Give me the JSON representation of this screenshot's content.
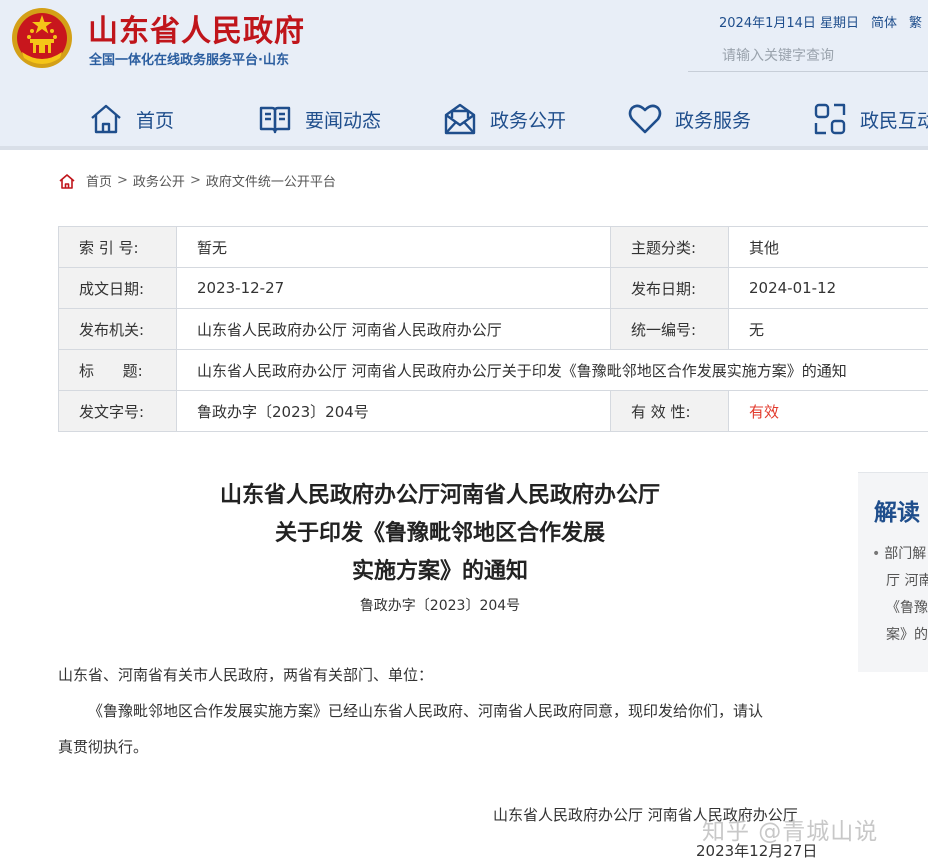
{
  "header": {
    "site_title": "山东省人民政府",
    "site_subtitle": "全国一体化在线政务服务平台·山东",
    "date": "2024年1月14日 星期日",
    "lang_simplified": "简体",
    "lang_traditional": "繁",
    "search_placeholder": "请输入关键字查询"
  },
  "nav": [
    {
      "label": "首页",
      "icon": "home-icon"
    },
    {
      "label": "要闻动态",
      "icon": "book-icon"
    },
    {
      "label": "政务公开",
      "icon": "mail-icon"
    },
    {
      "label": "政务服务",
      "icon": "heart-icon"
    },
    {
      "label": "政民互动",
      "icon": "interaction-icon"
    }
  ],
  "breadcrumb": [
    "首页",
    "政务公开",
    "政府文件统一公开平台"
  ],
  "meta": {
    "index_label": "索 引 号:",
    "index_value": "暂无",
    "topic_label": "主题分类:",
    "topic_value": "其他",
    "written_label": "成文日期:",
    "written_value": "2023-12-27",
    "publish_label": "发布日期:",
    "publish_value": "2024-01-12",
    "issuer_label": "发布机关:",
    "issuer_value": "山东省人民政府办公厅 河南省人民政府办公厅",
    "serial_label": "统一编号:",
    "serial_value": "无",
    "title_label": "标      题:",
    "title_value": "山东省人民政府办公厅 河南省人民政府办公厅关于印发《鲁豫毗邻地区合作发展实施方案》的通知",
    "docno_label": "发文字号:",
    "docno_value": "鲁政办字〔2023〕204号",
    "validity_label": "有 效 性:",
    "validity_value": "有效"
  },
  "article": {
    "title_line1": "山东省人民政府办公厅河南省人民政府办公厅",
    "title_line2": "关于印发《鲁豫毗邻地区合作发展",
    "title_line3": "实施方案》的通知",
    "doc_number": "鲁政办字〔2023〕204号",
    "salutation": "山东省、河南省有关市人民政府，两省有关部门、单位：",
    "body_line1": "《鲁豫毗邻地区合作发展实施方案》已经山东省人民政府、河南省人民政府同意，现印发给你们，请认",
    "body_line2": "真贯彻执行。",
    "signature": "山东省人民政府办公厅 河南省人民政府办公厅",
    "sign_date": "2023年12月27日"
  },
  "side": {
    "title": "解读",
    "lines": [
      "部门解",
      "厅 河南",
      "《鲁豫",
      "案》的"
    ]
  },
  "watermark": "知乎 @青城山说",
  "colors": {
    "brand_red": "#c0151b",
    "nav_blue": "#1f4e8c",
    "valid_red": "#e23a2c"
  }
}
